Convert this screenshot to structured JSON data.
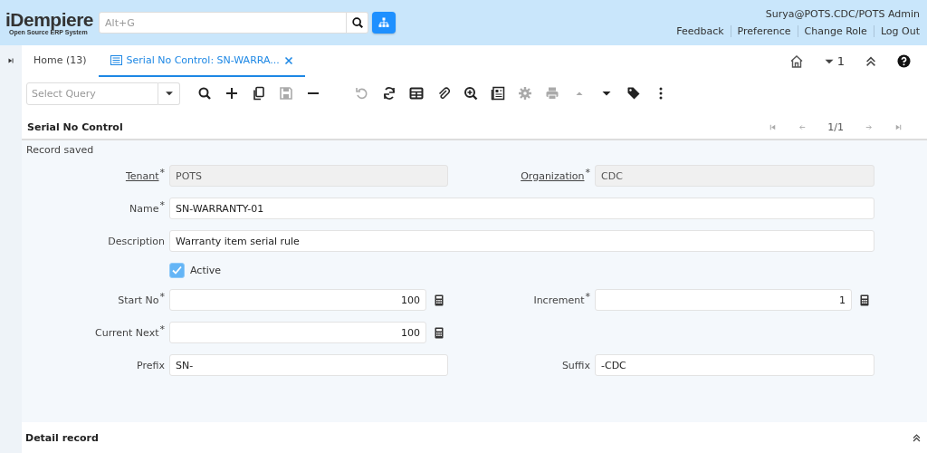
{
  "header": {
    "logo": {
      "title": "iDempiere",
      "subtitle": "Open Source ERP System"
    },
    "search": {
      "placeholder": "Alt+G"
    },
    "user": "Surya@POTS.CDC/POTS Admin",
    "links": [
      "Feedback",
      "Preference",
      "Change Role",
      "Log Out"
    ]
  },
  "tabs": [
    {
      "label": "Home (13)",
      "selected": false,
      "closable": false
    },
    {
      "label": "Serial No Control: SN-WARRA...",
      "selected": true,
      "closable": true
    }
  ],
  "window_counter": "1",
  "toolbar": {
    "query": {
      "placeholder": "Select Query"
    },
    "buttons": [
      {
        "kind": "search",
        "disabled": false
      },
      {
        "kind": "new",
        "disabled": false
      },
      {
        "kind": "copy",
        "disabled": false
      },
      {
        "kind": "save",
        "disabled": true
      },
      {
        "kind": "delete",
        "disabled": false
      },
      {
        "kind": "undo",
        "disabled": true
      },
      {
        "kind": "refresh",
        "disabled": false
      },
      {
        "kind": "grid",
        "disabled": false
      },
      {
        "kind": "attach",
        "disabled": false
      },
      {
        "kind": "zoom",
        "disabled": false
      },
      {
        "kind": "report",
        "disabled": false
      },
      {
        "kind": "gear",
        "disabled": true
      },
      {
        "kind": "print",
        "disabled": true
      },
      {
        "kind": "up",
        "disabled": true
      },
      {
        "kind": "down",
        "disabled": false
      },
      {
        "kind": "tag",
        "disabled": false
      },
      {
        "kind": "more",
        "disabled": false
      }
    ]
  },
  "panel": {
    "title": "Serial No Control",
    "record": "1/1",
    "nav": [
      {
        "kind": "first",
        "disabled": true
      },
      {
        "kind": "prev",
        "disabled": true
      },
      {
        "kind": "next",
        "disabled": true
      },
      {
        "kind": "last",
        "disabled": true
      }
    ]
  },
  "status": "Record saved",
  "rows": [
    [
      {
        "label": "Tenant",
        "required_mark": "*",
        "value": "POTS",
        "readonly": true,
        "link": true,
        "kind": "text"
      },
      {
        "label": "Organization",
        "required_mark": "*",
        "value": "CDC",
        "readonly": true,
        "link": true,
        "kind": "text"
      }
    ],
    [
      {
        "label": "Name",
        "required_mark": "*",
        "value": "SN-WARRANTY-01",
        "readonly": false,
        "link": false,
        "kind": "wide"
      }
    ],
    [
      {
        "label": "Description",
        "value": "Warranty item serial rule",
        "readonly": false,
        "link": false,
        "kind": "wide"
      }
    ],
    [
      {
        "label": "Active",
        "checked": true,
        "kind": "checkbox"
      }
    ],
    [
      {
        "label": "Start No",
        "required_mark": "*",
        "value": "100",
        "readonly": false,
        "link": false,
        "kind": "number"
      },
      {
        "label": "Increment",
        "required_mark": "*",
        "value": "1",
        "readonly": false,
        "link": false,
        "kind": "number"
      }
    ],
    [
      {
        "label": "Current Next",
        "required_mark": "*",
        "value": "100",
        "readonly": false,
        "link": false,
        "kind": "number"
      }
    ],
    [
      {
        "label": "Prefix",
        "value": "SN-",
        "readonly": false,
        "link": false,
        "kind": "text"
      },
      {
        "label": "Suffix",
        "value": "-CDC",
        "readonly": false,
        "link": false,
        "kind": "text"
      }
    ]
  ],
  "detail": {
    "title": "Detail record",
    "collapsed": false
  }
}
